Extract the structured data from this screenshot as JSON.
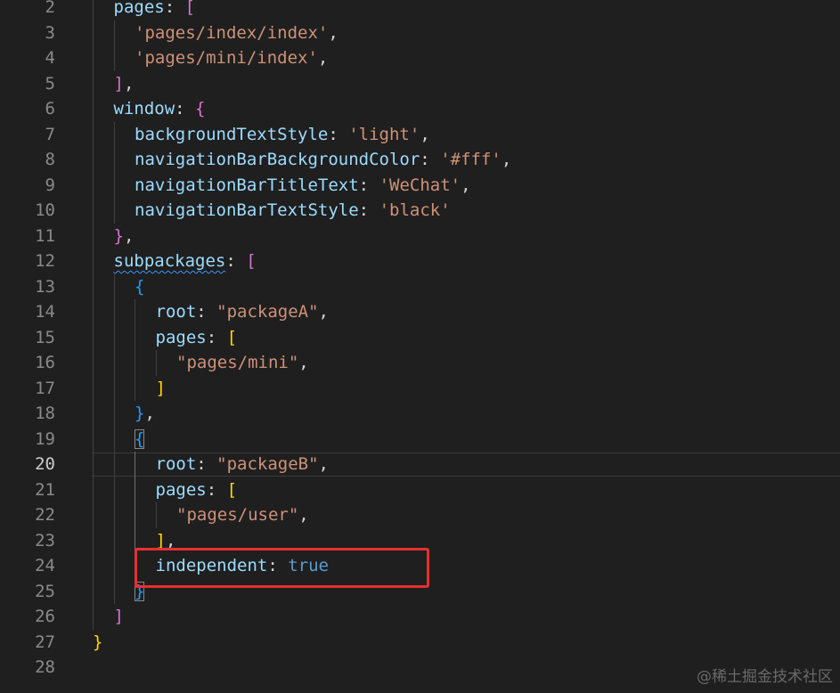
{
  "editor": {
    "lines": [
      {
        "n": "2",
        "indent": 1,
        "tokens": [
          {
            "t": "pages",
            "c": "k"
          },
          {
            "t": ": ",
            "c": "p"
          },
          {
            "t": "[",
            "c": "b1"
          }
        ]
      },
      {
        "n": "3",
        "indent": 2,
        "tokens": [
          {
            "t": "'pages/index/index'",
            "c": "s"
          },
          {
            "t": ",",
            "c": "p"
          }
        ]
      },
      {
        "n": "4",
        "indent": 2,
        "tokens": [
          {
            "t": "'pages/mini/index'",
            "c": "s"
          },
          {
            "t": ",",
            "c": "p"
          }
        ]
      },
      {
        "n": "5",
        "indent": 1,
        "tokens": [
          {
            "t": "]",
            "c": "b1"
          },
          {
            "t": ",",
            "c": "p"
          }
        ]
      },
      {
        "n": "6",
        "indent": 1,
        "tokens": [
          {
            "t": "window",
            "c": "k"
          },
          {
            "t": ": ",
            "c": "p"
          },
          {
            "t": "{",
            "c": "b1"
          }
        ]
      },
      {
        "n": "7",
        "indent": 2,
        "tokens": [
          {
            "t": "backgroundTextStyle",
            "c": "k"
          },
          {
            "t": ": ",
            "c": "p"
          },
          {
            "t": "'light'",
            "c": "s"
          },
          {
            "t": ",",
            "c": "p"
          }
        ]
      },
      {
        "n": "8",
        "indent": 2,
        "tokens": [
          {
            "t": "navigationBarBackgroundColor",
            "c": "k"
          },
          {
            "t": ": ",
            "c": "p"
          },
          {
            "t": "'#fff'",
            "c": "s"
          },
          {
            "t": ",",
            "c": "p"
          }
        ]
      },
      {
        "n": "9",
        "indent": 2,
        "tokens": [
          {
            "t": "navigationBarTitleText",
            "c": "k"
          },
          {
            "t": ": ",
            "c": "p"
          },
          {
            "t": "'WeChat'",
            "c": "s"
          },
          {
            "t": ",",
            "c": "p"
          }
        ]
      },
      {
        "n": "10",
        "indent": 2,
        "tokens": [
          {
            "t": "navigationBarTextStyle",
            "c": "k"
          },
          {
            "t": ": ",
            "c": "p"
          },
          {
            "t": "'black'",
            "c": "s"
          }
        ]
      },
      {
        "n": "11",
        "indent": 1,
        "tokens": [
          {
            "t": "}",
            "c": "b1"
          },
          {
            "t": ",",
            "c": "p"
          }
        ]
      },
      {
        "n": "12",
        "indent": 1,
        "tokens": [
          {
            "t": "subpackages",
            "c": "k squig"
          },
          {
            "t": ": ",
            "c": "p"
          },
          {
            "t": "[",
            "c": "b1"
          }
        ]
      },
      {
        "n": "13",
        "indent": 2,
        "tokens": [
          {
            "t": "{",
            "c": "b2"
          }
        ]
      },
      {
        "n": "14",
        "indent": 3,
        "tokens": [
          {
            "t": "root",
            "c": "k"
          },
          {
            "t": ": ",
            "c": "p"
          },
          {
            "t": "\"packageA\"",
            "c": "s"
          },
          {
            "t": ",",
            "c": "p"
          }
        ]
      },
      {
        "n": "15",
        "indent": 3,
        "tokens": [
          {
            "t": "pages",
            "c": "k"
          },
          {
            "t": ": ",
            "c": "p"
          },
          {
            "t": "[",
            "c": "b3"
          }
        ]
      },
      {
        "n": "16",
        "indent": 4,
        "tokens": [
          {
            "t": "\"pages/mini\"",
            "c": "s"
          },
          {
            "t": ",",
            "c": "p"
          }
        ]
      },
      {
        "n": "17",
        "indent": 3,
        "tokens": [
          {
            "t": "]",
            "c": "b3"
          }
        ]
      },
      {
        "n": "18",
        "indent": 2,
        "tokens": [
          {
            "t": "}",
            "c": "b2"
          },
          {
            "t": ",",
            "c": "p"
          }
        ]
      },
      {
        "n": "19",
        "indent": 2,
        "tokens": [
          {
            "t": "{",
            "c": "b2 bracket-match"
          }
        ]
      },
      {
        "n": "20",
        "indent": 3,
        "current": true,
        "tokens": [
          {
            "t": "root",
            "c": "k"
          },
          {
            "t": ": ",
            "c": "p"
          },
          {
            "t": "\"packageB\"",
            "c": "s"
          },
          {
            "t": ",",
            "c": "p"
          }
        ]
      },
      {
        "n": "21",
        "indent": 3,
        "tokens": [
          {
            "t": "pages",
            "c": "k"
          },
          {
            "t": ": ",
            "c": "p"
          },
          {
            "t": "[",
            "c": "b3"
          }
        ]
      },
      {
        "n": "22",
        "indent": 4,
        "tokens": [
          {
            "t": "\"pages/user\"",
            "c": "s"
          },
          {
            "t": ",",
            "c": "p"
          }
        ]
      },
      {
        "n": "23",
        "indent": 3,
        "tokens": [
          {
            "t": "]",
            "c": "b3"
          },
          {
            "t": ",",
            "c": "p"
          }
        ]
      },
      {
        "n": "24",
        "indent": 3,
        "tokens": [
          {
            "t": "independent",
            "c": "k"
          },
          {
            "t": ": ",
            "c": "p"
          },
          {
            "t": "true",
            "c": "bool"
          }
        ]
      },
      {
        "n": "25",
        "indent": 2,
        "tokens": [
          {
            "t": "}",
            "c": "b2 bracket-match"
          }
        ]
      },
      {
        "n": "26",
        "indent": 1,
        "tokens": [
          {
            "t": "]",
            "c": "b1"
          }
        ]
      },
      {
        "n": "27",
        "indent": 0,
        "tokens": [
          {
            "t": "}",
            "c": "b3"
          }
        ]
      },
      {
        "n": "28",
        "indent": 0,
        "tokens": []
      }
    ]
  },
  "watermark": "@稀土掘金技术社区",
  "colors": {
    "background": "#1f1f1f",
    "highlight_box": "#e8302f"
  }
}
